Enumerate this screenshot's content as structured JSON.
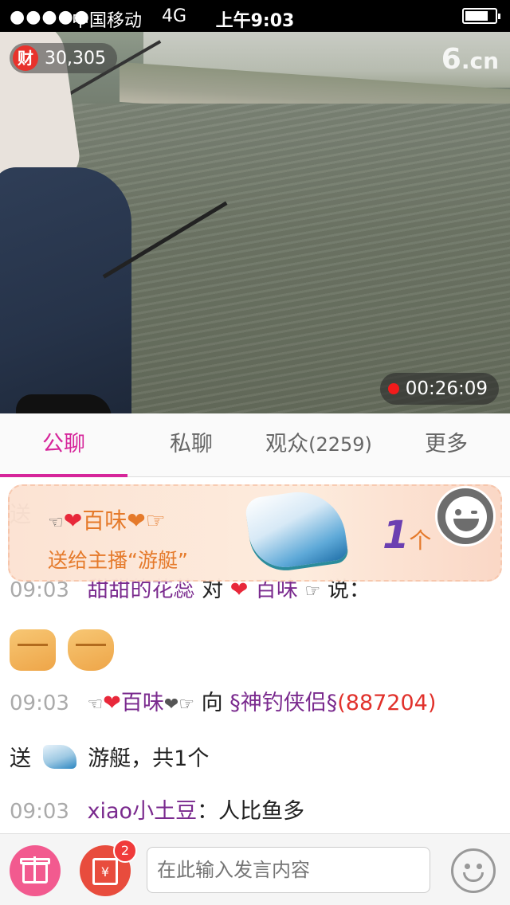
{
  "status_bar": {
    "signal": "●●●●●",
    "carrier": "中国移动",
    "network": "4G",
    "time": "上午9:03"
  },
  "video": {
    "wealth_icon_label": "财",
    "wealth_value": "30,305",
    "brand_logo": "6",
    "brand_logo_suffix": ".cn",
    "duration": "00:26:09"
  },
  "tabs": [
    {
      "label": "公聊",
      "active": true
    },
    {
      "label": "私聊",
      "active": false
    },
    {
      "label": "观众",
      "count": "(2259)",
      "active": false
    },
    {
      "label": "更多",
      "active": false
    }
  ],
  "gift_banner": {
    "sender_prefix": "☜",
    "sender_heart": "❤",
    "sender_name": "百味",
    "sender_suffix": "❤☞",
    "description": "送给主播“游艇”",
    "quantity": "1",
    "unit": "个"
  },
  "chat": {
    "partial_top_char": "送",
    "line_hidden": {
      "time": "09:03",
      "user": "甜甜的花蕊",
      "verb": "对",
      "target_heart": "❤",
      "target": "百味",
      "target_suffix": "☞",
      "tail": "说："
    },
    "line_gift": {
      "time": "09:03",
      "sender_prefix": "☜",
      "sender_heart": "❤",
      "sender": "百味",
      "sender_suffix": "❤☞",
      "verb": "向",
      "receiver": "§神钓侠侣§",
      "receiver_id": "(887204)",
      "send_word": "送",
      "gift_name": "游艇，共1个"
    },
    "line_msg": {
      "time": "09:03",
      "user": "xiao小土豆",
      "colon": "：",
      "text": "人比鱼多"
    }
  },
  "bottom_bar": {
    "input_placeholder": "在此输入发言内容",
    "redpack_label": "¥",
    "redpack_badge": "2"
  },
  "colors": {
    "accent": "#d6259a",
    "username": "#7a2a8e",
    "receiver_id": "#e1312b",
    "banner_text": "#e57a2b"
  }
}
